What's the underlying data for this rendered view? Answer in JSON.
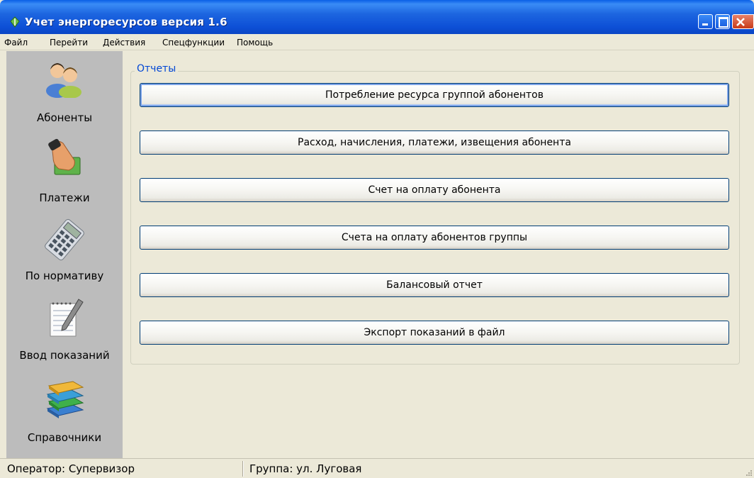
{
  "window": {
    "title": "Учет энергоресурсов версия 1.6",
    "app_icon": "leaf-app-icon",
    "controls": [
      "minimize-icon",
      "maximize-icon",
      "close-icon"
    ]
  },
  "menu": {
    "items": [
      "Файл",
      "Перейти",
      "Действия",
      "Спецфункции",
      "Помощь"
    ]
  },
  "sidebar": {
    "items": [
      {
        "label": "Абоненты",
        "icon": "users-icon"
      },
      {
        "label": "Платежи",
        "icon": "payment-hand-icon"
      },
      {
        "label": "По нормативу",
        "icon": "calculator-icon"
      },
      {
        "label": "Ввод показаний",
        "icon": "notepad-pencil-icon"
      },
      {
        "label": "Справочники",
        "icon": "books-icon"
      }
    ]
  },
  "reports": {
    "title": "Отчеты",
    "buttons": [
      "Потребление ресурса группой абонентов",
      "Расход, начисления, платежи, извещения абонента",
      "Счет на оплату абонента",
      "Счета на оплату абонентов группы",
      "Балансовый отчет",
      "Экспорт показаний в файл"
    ]
  },
  "status": {
    "operator": "Оператор: Супервизор",
    "group": "Группа: ул. Луговая"
  },
  "colors": {
    "title_bar": "#0a46c4",
    "group_title": "#0046d5",
    "sidebar_bg": "#bcbcbc",
    "window_bg": "#ece9d8"
  }
}
